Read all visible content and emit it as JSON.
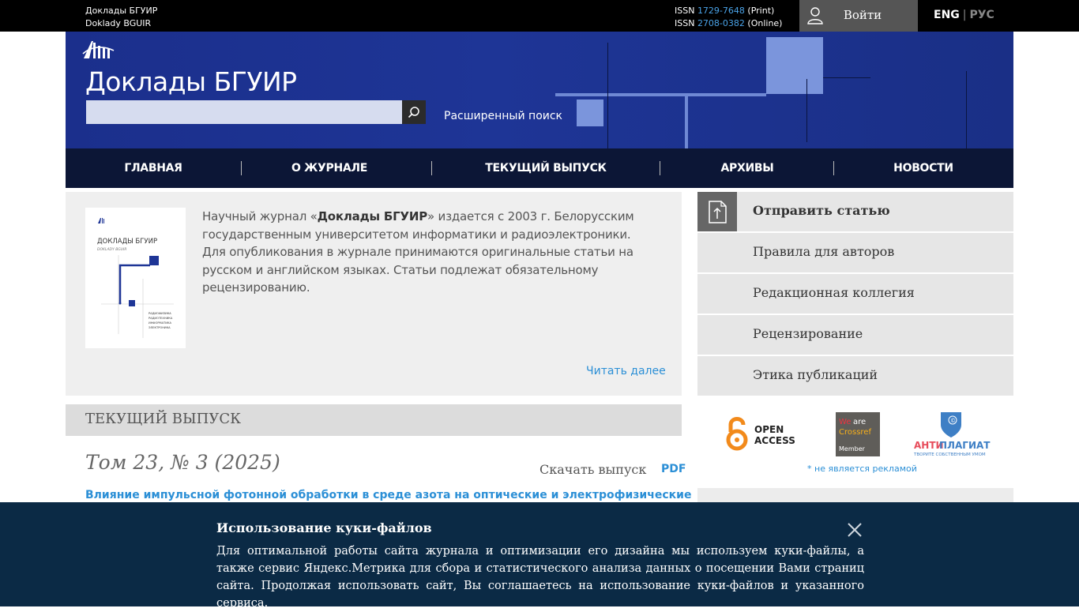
{
  "topbar": {
    "site_name_ru": "Доклады БГУИР",
    "site_name_en": "Doklady BGUIR",
    "issn_print_label": "ISSN",
    "issn_print_number": "1729-7648",
    "issn_print_type": "(Print)",
    "issn_online_label": "ISSN",
    "issn_online_number": "2708-0382",
    "issn_online_type": "(Online)",
    "login_label": "Войти",
    "lang_en": "ENG",
    "lang_sep": "|",
    "lang_ru": "РУС"
  },
  "header": {
    "title": "Доклады БГУИР",
    "advanced_search": "Расширенный поиск"
  },
  "nav": {
    "items": [
      "ГЛАВНАЯ",
      "О ЖУРНАЛЕ",
      "ТЕКУЩИЙ ВЫПУСК",
      "АРХИВЫ",
      "НОВОСТИ"
    ]
  },
  "about": {
    "text_1": "Научный журнал «",
    "text_bold": "Доклады БГУИР",
    "text_2": "» издается с 2003 г. Белорусским государственным университетом информатики и радиоэлектроники.",
    "text_3": "Для опубликования в журнале принимаются оригинальные статьи на русском и английском языках. Статьи подлежат обязательному рецензированию.",
    "read_more": "Читать далее",
    "cover": {
      "title": "ДОКЛАДЫ БГУИР",
      "subtitle": "DOKLADY BGUIR",
      "topics": [
        "РАДИОФИЗИКА",
        "РАДИОТЕХНИКА",
        "ИНФОРМАТИКА",
        "ЭЛЕКТРОНИКА"
      ]
    }
  },
  "current": {
    "heading": "ТЕКУЩИЙ ВЫПУСК",
    "issue_title": "Том 23, № 3 (2025)",
    "download_label": "Скачать выпуск",
    "pdf_label": "PDF",
    "article_title": "Влияние импульсной фотонной обработки в среде азота на оптические и электрофизические"
  },
  "sidebar": {
    "items": [
      "Отправить статью",
      "Правила для авторов",
      "Редакционная коллегия",
      "Рецензирование",
      "Этика публикаций"
    ],
    "badges": {
      "open_access_1": "OPEN",
      "open_access_2": "ACCESS",
      "crossref_1": "We",
      "crossref_2": "are",
      "crossref_3": "Crossref",
      "crossref_4": "Member",
      "antiplagiat_1": "АНТИ",
      "antiplagiat_2": "ПЛАГИАТ",
      "antiplagiat_slogan": "ТВОРИТЕ СОБСТВЕННЫМ УМОМ"
    },
    "not_ad": "* не является рекламой"
  },
  "cookie": {
    "title": "Использование куки-файлов",
    "text": "Для оптимальной работы сайта журнала и оптимизации его дизайна мы используем куки-файлы, а также сервис Яндекс.Метрика для сбора и статистического анализа данных о посещении Вами страниц сайта. Продолжая использовать сайт, Вы соглашаетесь на использование куки-файлов и указанного сервиса."
  },
  "colors": {
    "header_blue": "#1e3596",
    "nav_dark": "#0c1636",
    "link_blue": "#2b8fd6",
    "cookie_bg": "#0b2a45"
  }
}
